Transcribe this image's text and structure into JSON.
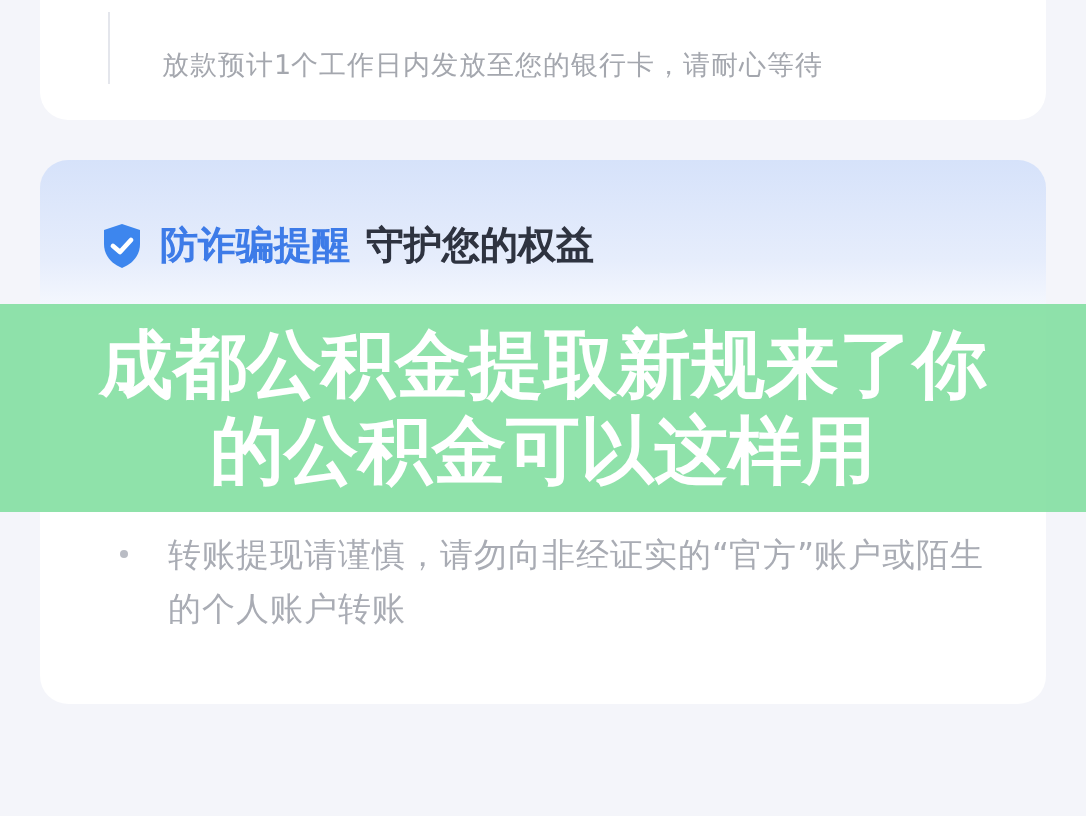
{
  "top_card": {
    "description": "放款预计1个工作日内发放至您的银行卡，请耐心等待"
  },
  "notice": {
    "title_highlight": "防诈骗提醒",
    "title": "守护您的权益",
    "items": [
      "转账提现请谨慎，请勿向非经证实的“官方”账户或陌生的个人账户转账"
    ]
  },
  "banner": {
    "title": "成都公积金提取新规来了你的公积金可以这样用"
  }
}
